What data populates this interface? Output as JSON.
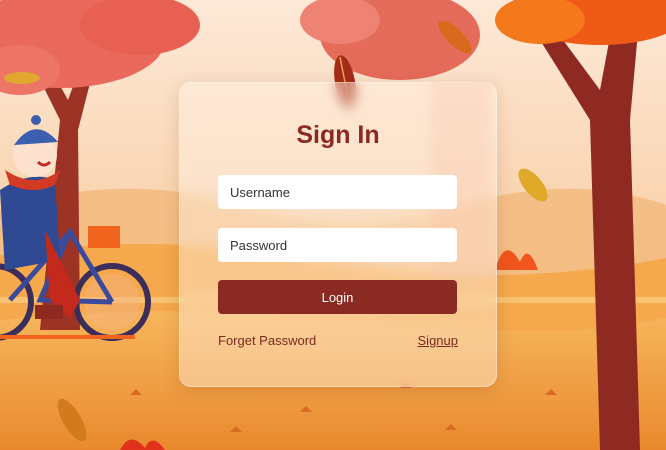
{
  "form": {
    "title": "Sign In",
    "username_placeholder": "Username",
    "password_placeholder": "Password",
    "login_label": "Login",
    "forgot_label": "Forget Password",
    "signup_label": "Signup"
  },
  "colors": {
    "accent": "#8b2a22",
    "sky": "#f6c9a6",
    "ground": "#f2a84a"
  },
  "icons": [
    "autumn-scene",
    "tree",
    "leaf",
    "cyclist",
    "bicycle"
  ]
}
